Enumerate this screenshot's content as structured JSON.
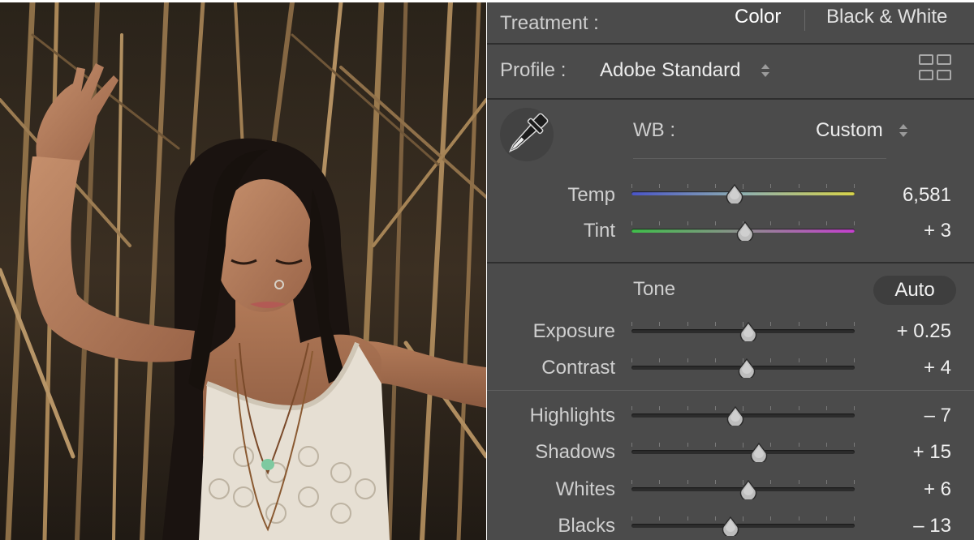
{
  "treatment": {
    "label": "Treatment :",
    "options": [
      "Color",
      "Black & White"
    ],
    "selected": "Color"
  },
  "profile": {
    "label": "Profile :",
    "value": "Adobe Standard",
    "browse_icon": "grid-icon"
  },
  "white_balance": {
    "picker_icon": "eyedropper-icon",
    "label": "WB :",
    "value": "Custom"
  },
  "sliders_wb": [
    {
      "id": "temp",
      "label": "Temp",
      "value": "6,581",
      "position": 0.46,
      "track": "temp"
    },
    {
      "id": "tint",
      "label": "Tint",
      "value": "+ 3",
      "position": 0.51,
      "track": "tint"
    }
  ],
  "tone": {
    "label": "Tone",
    "auto_label": "Auto"
  },
  "sliders_tone": [
    {
      "id": "exposure",
      "label": "Exposure",
      "value": "+ 0.25",
      "position": 0.525
    },
    {
      "id": "contrast",
      "label": "Contrast",
      "value": "+ 4",
      "position": 0.515
    }
  ],
  "sliders_presence": [
    {
      "id": "highlights",
      "label": "Highlights",
      "value": "– 7",
      "position": 0.465
    },
    {
      "id": "shadows",
      "label": "Shadows",
      "value": "+ 15",
      "position": 0.57
    },
    {
      "id": "whites",
      "label": "Whites",
      "value": "+ 6",
      "position": 0.525
    },
    {
      "id": "blacks",
      "label": "Blacks",
      "value": "– 13",
      "position": 0.445
    }
  ],
  "colors": {
    "panel_bg": "#4b4b4b",
    "temp_track_start": "#4a55c8",
    "temp_track_end": "#d8d44a",
    "tint_track_start": "#3fbf4a",
    "tint_track_end": "#c63fd0",
    "neutral_track": "#2c2c2c"
  }
}
